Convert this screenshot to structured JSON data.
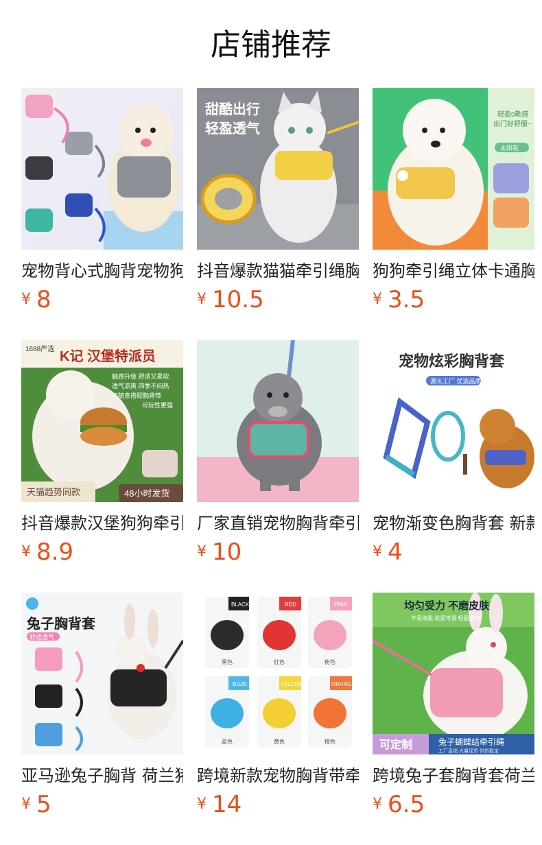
{
  "page": {
    "title": "店铺推荐"
  },
  "colors": {
    "price": "#ef4d16",
    "text": "#222222"
  },
  "products": [
    {
      "name": "宠物背心式胸背宠物狗",
      "currency": "¥",
      "price": "8",
      "image": {
        "icon": "dog-harness-product-photo",
        "lines": []
      }
    },
    {
      "name": "抖音爆款猫猫牵引绳胸",
      "currency": "¥",
      "price": "10.5",
      "image": {
        "icon": "cat-harness-product-photo",
        "lines": [
          "甜酷出行",
          "轻盈透气"
        ]
      }
    },
    {
      "name": "狗狗牵引绳立体卡通胸",
      "currency": "¥",
      "price": "3.5",
      "image": {
        "icon": "bichon-harness-product-photo",
        "lines": [
          "轻盈0勒感",
          "出门好舒服~",
          "太阳花"
        ]
      }
    },
    {
      "name": "抖音爆款汉堡狗狗牵引",
      "currency": "¥",
      "price": "8.9",
      "image": {
        "icon": "burger-harness-product-photo",
        "lines": [
          "1688严选",
          "K记 汉堡特派员",
          "触感升级 舒适又柔软",
          "透气凉爽 四季不闷热",
          "可随意搭配胸背带",
          "可玩性更强",
          "天猫趋势同款",
          "48小时发货"
        ]
      }
    },
    {
      "name": "厂家直销宠物胸背牵引",
      "currency": "¥",
      "price": "10",
      "image": {
        "icon": "schnauzer-harness-product-photo",
        "lines": []
      }
    },
    {
      "name": "宠物渐变色胸背套 新款",
      "currency": "¥",
      "price": "4",
      "image": {
        "icon": "gradient-harness-product-photo",
        "lines": [
          "宠物炫彩胸背套",
          "源头工厂 优选品质"
        ]
      }
    },
    {
      "name": "亚马逊兔子胸背 荷兰猪",
      "currency": "¥",
      "price": "5",
      "image": {
        "icon": "rabbit-harness-product-photo",
        "lines": [
          "兔子胸背套",
          "舒适透气"
        ]
      }
    },
    {
      "name": "跨境新款宠物胸背带牵",
      "currency": "¥",
      "price": "14",
      "image": {
        "icon": "color-harness-grid-photo",
        "lines": [
          "BLACK",
          "RED",
          "PINK",
          "BLUE",
          "YELLOW",
          "ORANGE",
          "黑色",
          "红色",
          "粉色",
          "蓝色",
          "黄色",
          "橙色"
        ]
      }
    },
    {
      "name": "跨境兔子套胸背套荷兰",
      "currency": "¥",
      "price": "6.5",
      "image": {
        "icon": "bunny-bow-harness-photo",
        "lines": [
          "均匀受力 不磨皮肤",
          "不易挣脱 松紧可调 轻盈透气",
          "可定制",
          "兔子蝴蝶结牵引绳",
          "工厂直销 大量现货 供货稳定"
        ]
      }
    }
  ]
}
